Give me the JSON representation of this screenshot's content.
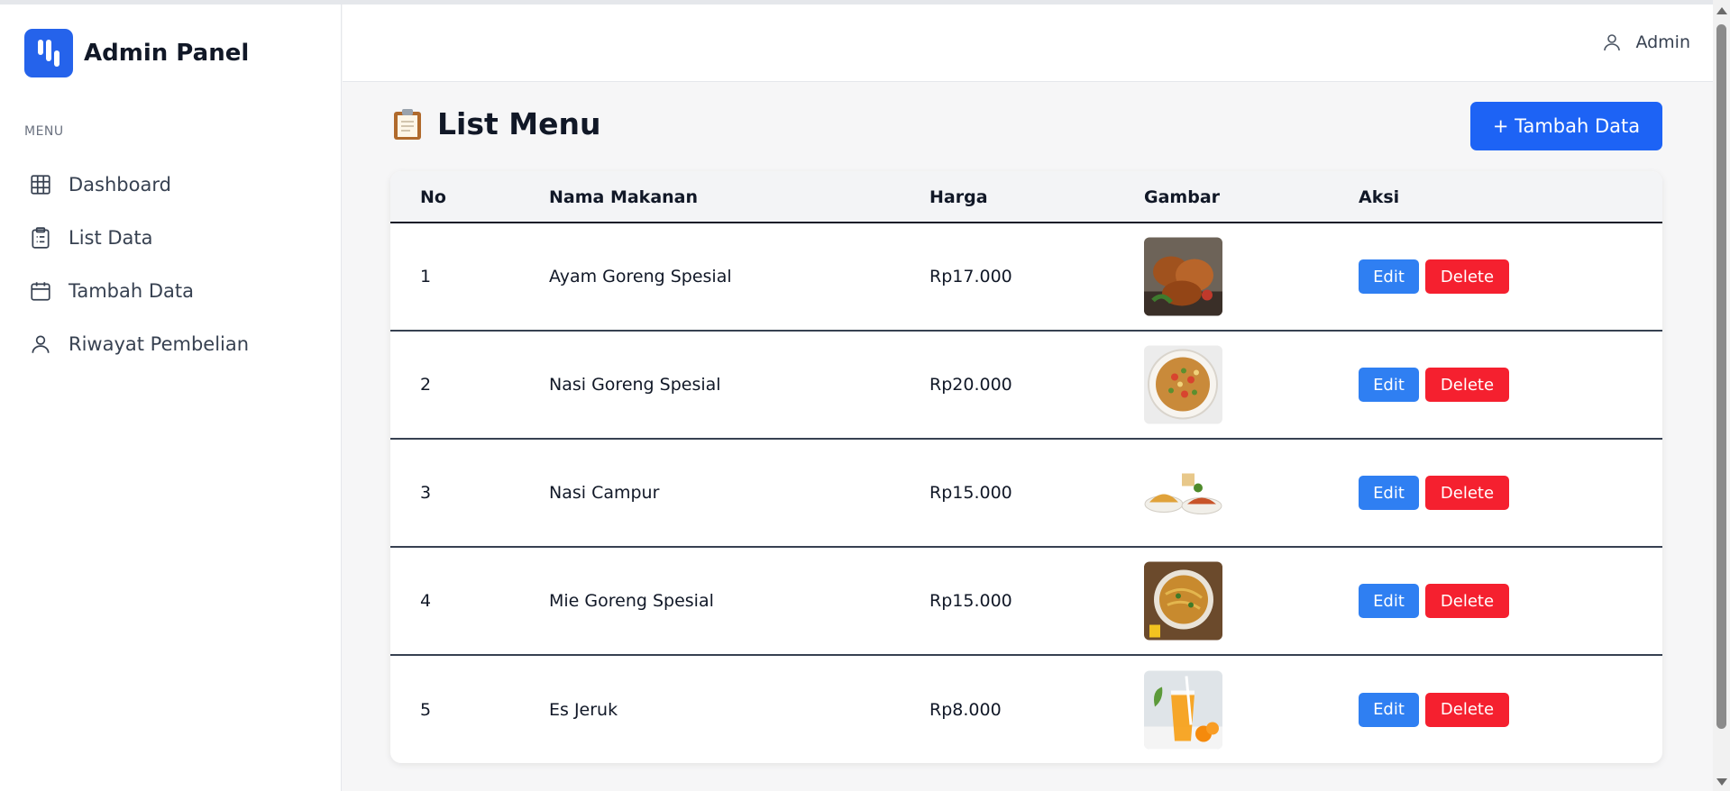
{
  "brand": {
    "title": "Admin Panel",
    "color": "#2563eb"
  },
  "sidebar": {
    "menu_label": "MENU",
    "items": [
      {
        "label": "Dashboard",
        "icon": "grid-icon"
      },
      {
        "label": "List Data",
        "icon": "clipboard-list-icon"
      },
      {
        "label": "Tambah Data",
        "icon": "calendar-icon"
      },
      {
        "label": "Riwayat Pembelian",
        "icon": "user-icon"
      }
    ]
  },
  "header": {
    "user_label": "Admin",
    "user_icon": "user-icon"
  },
  "page": {
    "title": "List Menu",
    "title_icon": "clipboard-icon",
    "add_button": "+ Tambah Data"
  },
  "table": {
    "columns": [
      "No",
      "Nama Makanan",
      "Harga",
      "Gambar",
      "Aksi"
    ],
    "rows": [
      {
        "no": "1",
        "name": "Ayam Goreng Spesial",
        "price": "Rp17.000",
        "image": "fried-chicken"
      },
      {
        "no": "2",
        "name": "Nasi Goreng Spesial",
        "price": "Rp20.000",
        "image": "fried-rice"
      },
      {
        "no": "3",
        "name": "Nasi Campur",
        "price": "Rp15.000",
        "image": "mixed-rice"
      },
      {
        "no": "4",
        "name": "Mie Goreng Spesial",
        "price": "Rp15.000",
        "image": "fried-noodles"
      },
      {
        "no": "5",
        "name": "Es Jeruk",
        "price": "Rp8.000",
        "image": "orange-juice"
      }
    ],
    "edit_label": "Edit",
    "delete_label": "Delete"
  },
  "colors": {
    "primary": "#1d63f5",
    "edit": "#2f7ff2",
    "delete": "#f5202f"
  }
}
